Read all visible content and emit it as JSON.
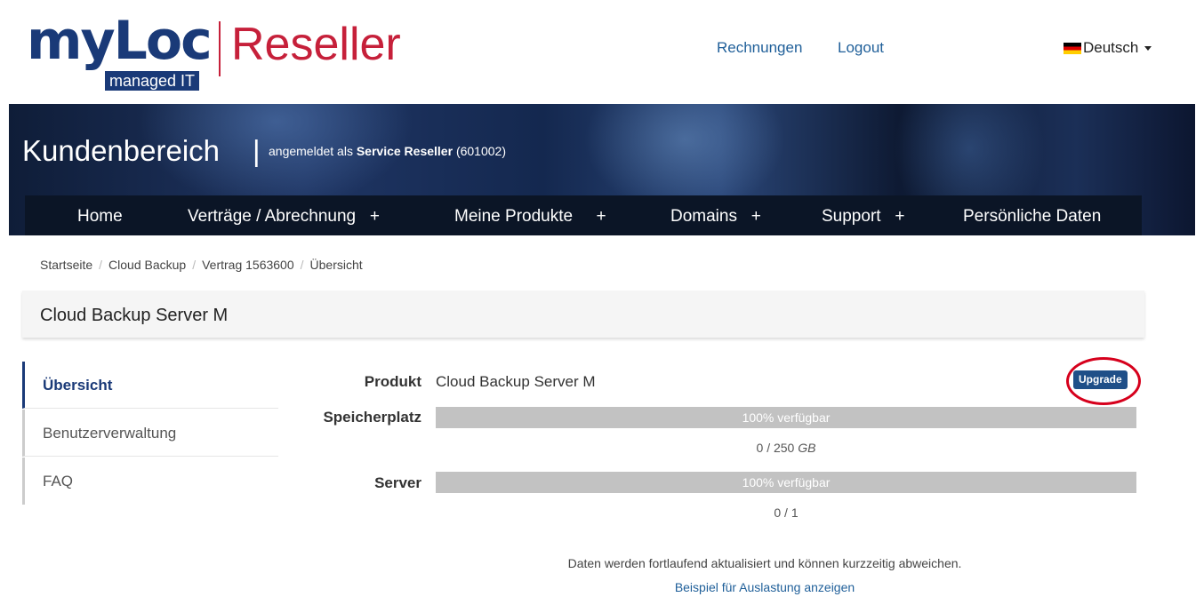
{
  "header": {
    "logo_text": "myLoc",
    "logo_sub": "managed IT",
    "logo_product": "Reseller",
    "links": [
      "Rechnungen",
      "Logout"
    ],
    "language": "Deutsch",
    "brand_color": "#1a3a78",
    "accent_color": "#c6203a"
  },
  "banner": {
    "title": "Kundenbereich",
    "separator": "|",
    "logged_in_prefix": "angemeldet als",
    "user_name": "Service Reseller",
    "user_id": "(601002)"
  },
  "nav": {
    "items": [
      {
        "label": "Home"
      },
      {
        "label": "Verträge / Abrechnung   +"
      },
      {
        "label": "Meine Produkte     +"
      },
      {
        "label": "Domains   +"
      },
      {
        "label": "Support   +"
      },
      {
        "label": "Persönliche Daten"
      }
    ]
  },
  "breadcrumb": [
    "Startseite",
    "Cloud Backup",
    "Vertrag 1563600",
    "Übersicht"
  ],
  "page_title": "Cloud Backup Server M",
  "side_menu": [
    {
      "label": "Übersicht",
      "active": true
    },
    {
      "label": "Benutzerverwaltung",
      "active": false
    },
    {
      "label": "FAQ",
      "active": false
    }
  ],
  "details": {
    "product_label": "Produkt",
    "product_value": "Cloud Backup Server M",
    "upgrade_label": "Upgrade",
    "storage_label": "Speicherplatz",
    "storage_bar_text": "100% verfügbar",
    "storage_available_fraction": 1.0,
    "storage_usage_value": "0 / 250",
    "storage_usage_unit": "GB",
    "server_label": "Server",
    "server_bar_text": "100% verfügbar",
    "server_available_fraction": 1.0,
    "server_usage": "0 / 1"
  },
  "footer": {
    "note": "Daten werden fortlaufend aktualisiert und können kurzzeitig abweichen.",
    "link": "Beispiel für Auslastung anzeigen"
  }
}
